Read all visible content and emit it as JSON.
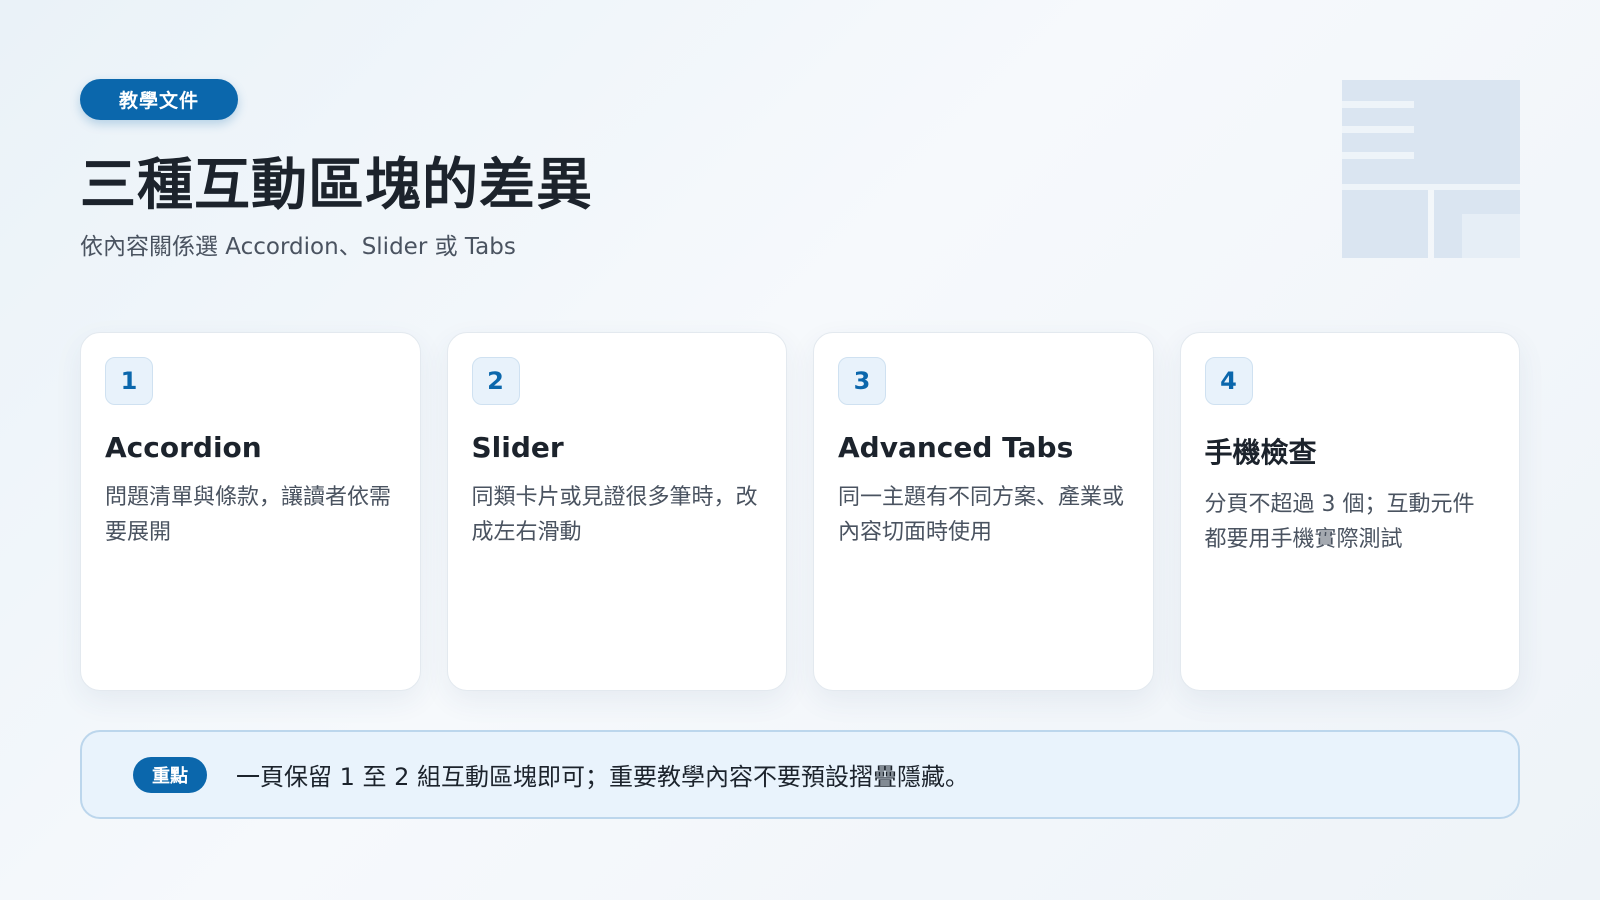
{
  "header": {
    "tag": "教學文件",
    "title": "三種互動區塊的差異",
    "subtitle": "依內容關係選 Accordion、Slider 或 Tabs"
  },
  "cards": [
    {
      "number": "1",
      "title": "Accordion",
      "description": "問題清單與條款，讓讀者依需要展開"
    },
    {
      "number": "2",
      "title": "Slider",
      "description": "同類卡片或見證很多筆時，改成左右滑動"
    },
    {
      "number": "3",
      "title": "Advanced Tabs",
      "description": "同一主題有不同方案、產業或內容切面時使用"
    },
    {
      "number": "4",
      "title": "手機檢查",
      "description": "分頁不超過 3 個；互動元件都要用手機實際測試"
    }
  ],
  "note": {
    "badge": "重點",
    "text": "一頁保留 1 至 2 組互動區塊即可；重要教學內容不要預設摺疊隱藏。"
  },
  "colors": {
    "accent": "#0b67ac",
    "note_bg": "#e9f3fc",
    "deco": "#d3e1ed"
  },
  "icons": {
    "decoration": "layout-grid-icon"
  }
}
